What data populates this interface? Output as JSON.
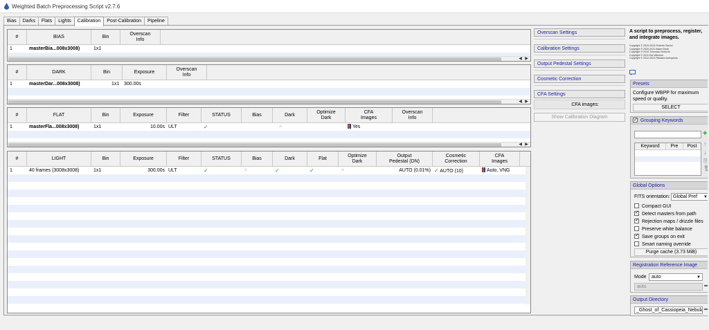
{
  "window": {
    "title": "Weighted Batch Preprocessing Script v2.7.6"
  },
  "tabs": [
    "Bias",
    "Darks",
    "Flats",
    "Lights",
    "Calibration",
    "Post-Calibration",
    "Pipeline"
  ],
  "bias": {
    "headers": [
      "#",
      "BIAS",
      "Bin",
      "Overscan\nInfo"
    ],
    "rows": [
      {
        "n": "1",
        "name": "masterBia...008x3008)",
        "bin": "1x1"
      }
    ]
  },
  "dark": {
    "headers": [
      "#",
      "DARK",
      "Bin",
      "Exposure",
      "Overscan\nInfo"
    ],
    "rows": [
      {
        "n": "1",
        "name": "masterDar...008x3008)",
        "bin": "1x1",
        "exposure": "300.00s"
      }
    ]
  },
  "flat": {
    "headers": [
      "#",
      "FLAT",
      "Bin",
      "Exposure",
      "Filter",
      "STATUS",
      "Bias",
      "Dark",
      "Optimize\nDark",
      "CFA\nImages",
      "Overscan\nInfo"
    ],
    "rows": [
      {
        "n": "1",
        "name": "masterFla...008x3008)",
        "bin": "1x1",
        "exposure": "10.00s",
        "filter": "ULT",
        "cfa": "Yes"
      }
    ]
  },
  "light": {
    "headers": [
      "#",
      "LIGHT",
      "Bin",
      "Exposure",
      "Filter",
      "STATUS",
      "Bias",
      "Dark",
      "Flat",
      "Optimize\nDark",
      "Output\nPedestal (DN)",
      "Cosmetic\nCorrection",
      "CFA\nImages"
    ],
    "rows": [
      {
        "n": "1",
        "name": "40 frames (3008x3008)",
        "bin": "1x1",
        "exposure": "300.00s",
        "filter": "ULT",
        "pedestal": "AUTO (0.01%)",
        "cosmetic": "AUTO (10)",
        "cfa": "Auto, VNG"
      }
    ]
  },
  "settings": {
    "overscan": "Overscan Settings",
    "calibration": "Calibration Settings",
    "pedestal": "Output Pedestal Settings",
    "cosmetic": "Cosmetic Correction",
    "cfa": "CFA Settings",
    "cfa_images": "CFA images:",
    "show_diagram": "Show Calibration Diagram"
  },
  "about": {
    "headline": "A script to preprocess, register, and integrate images.",
    "copyrights": [
      "Copyright © 2019-2024 Roberto Sartori",
      "Copyright © 2020-2021 Adam Block",
      "Copyright © 2019 Tommaso Rubechi",
      "Copyright © 2012 Kai Wiechen",
      "Copyright © 2012-2024 Pleiades Astrophoto"
    ]
  },
  "presets": {
    "title": "Presets",
    "text": "Configure WBPP for maximum speed or quality.",
    "button": "SELECT"
  },
  "grouping": {
    "title": "Grouping Keywords",
    "cols": [
      "Keyword",
      "Pre",
      "Post"
    ]
  },
  "global": {
    "title": "Global Options",
    "fits_label": "FITS orientation:",
    "fits_value": "Global Pref",
    "options": [
      {
        "label": "Compact GUI",
        "on": false
      },
      {
        "label": "Detect masters from path",
        "on": true
      },
      {
        "label": "Rejection maps / drizzle files",
        "on": true
      },
      {
        "label": "Preserve white balance",
        "on": false
      },
      {
        "label": "Save groups on exit",
        "on": true
      },
      {
        "label": "Smart naming override",
        "on": false
      }
    ],
    "purge": "Purge cache (3.73 MiB)"
  },
  "registration": {
    "title": "Registration Reference Image",
    "mode_label": "Mode",
    "mode_value": "auto",
    "path": "auto"
  },
  "output": {
    "title": "Output Directory",
    "path": "_Ghost_of_Cassiopeia_Nebula"
  }
}
